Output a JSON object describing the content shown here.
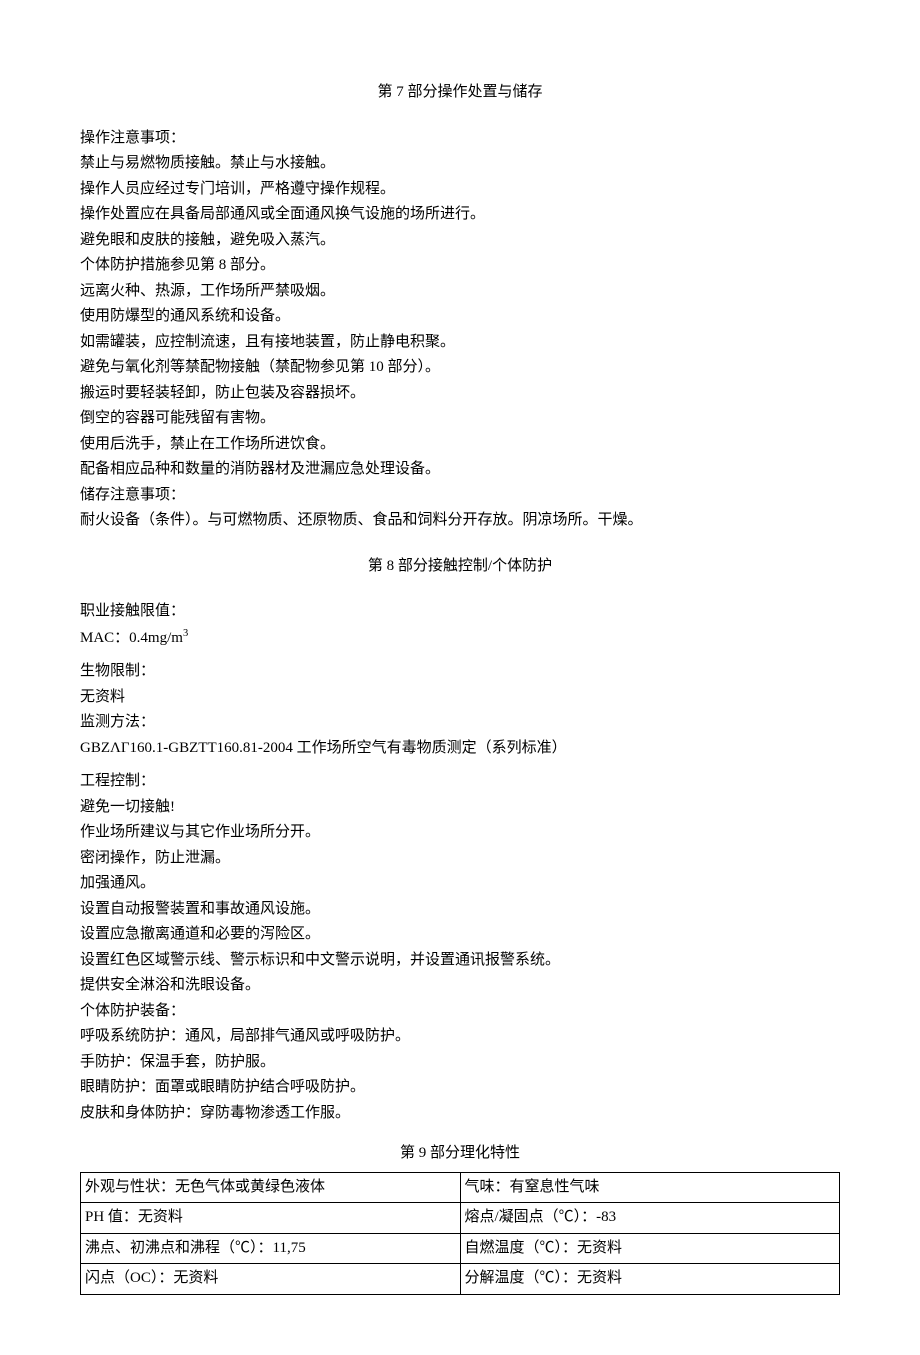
{
  "section7": {
    "title": "第 7 部分操作处置与储存",
    "op_heading": "操作注意事项：",
    "op_lines": [
      "禁止与易燃物质接触。禁止与水接触。",
      "操作人员应经过专门培训，严格遵守操作规程。",
      "操作处置应在具备局部通风或全面通风换气设施的场所进行。",
      "避免眼和皮肤的接触，避免吸入蒸汽。",
      "个体防护措施参见第 8 部分。",
      "远离火种、热源，工作场所严禁吸烟。",
      "使用防爆型的通风系统和设备。",
      "如需罐装，应控制流速，且有接地装置，防止静电积聚。",
      "避免与氧化剂等禁配物接触（禁配物参见第 10 部分）。",
      "搬运时要轻装轻卸，防止包装及容器损坏。",
      "倒空的容器可能残留有害物。",
      "使用后洗手，禁止在工作场所进饮食。",
      "配备相应品种和数量的消防器材及泄漏应急处理设备。"
    ],
    "storage_heading": "储存注意事项：",
    "storage_line": "耐火设备（条件）。与可燃物质、还原物质、食品和饲料分开存放。阴凉场所。干燥。"
  },
  "section8": {
    "title": "第 8 部分接触控制/个体防护",
    "exposure_heading": "职业接触限值：",
    "mac": "MAC：0.4mg/m",
    "mac_sup": "3",
    "bio_heading": "生物限制：",
    "bio_value": "无资料",
    "monitor_heading": "监测方法：",
    "monitor_value": "GBZΛΓ160.1-GBZTT160.81-2004 工作场所空气有毒物质测定（系列标准）",
    "eng_heading": "工程控制：",
    "eng_lines": [
      "避免一切接触!",
      "作业场所建议与其它作业场所分开。",
      "密闭操作，防止泄漏。",
      "加强通风。",
      "设置自动报警装置和事故通风设施。",
      "设置应急撤离通道和必要的泻险区。",
      "设置红色区域警示线、警示标识和中文警示说明，并设置通讯报警系统。",
      "提供安全淋浴和洗眼设备。"
    ],
    "ppe_heading": "个体防护装备：",
    "ppe_lines": [
      "呼吸系统防护：通风，局部排气通风或呼吸防护。",
      "手防护：保温手套，防护服。",
      "眼睛防护：面罩或眼睛防护结合呼吸防护。",
      "皮肤和身体防护：穿防毒物渗透工作服。"
    ]
  },
  "section9": {
    "title": "第 9 部分理化特性",
    "rows": [
      {
        "l": "外观与性状：无色气体或黄绿色液体",
        "r": "气味：有窒息性气味"
      },
      {
        "l": "PH 值：无资料",
        "r": "熔点/凝固点（℃）：-83"
      },
      {
        "l": "沸点、初沸点和沸程（℃）：11,75",
        "r": "自燃温度（℃）：无资料"
      },
      {
        "l": "闪点（OC）：无资料",
        "r": "分解温度（℃）：无资料"
      }
    ]
  }
}
